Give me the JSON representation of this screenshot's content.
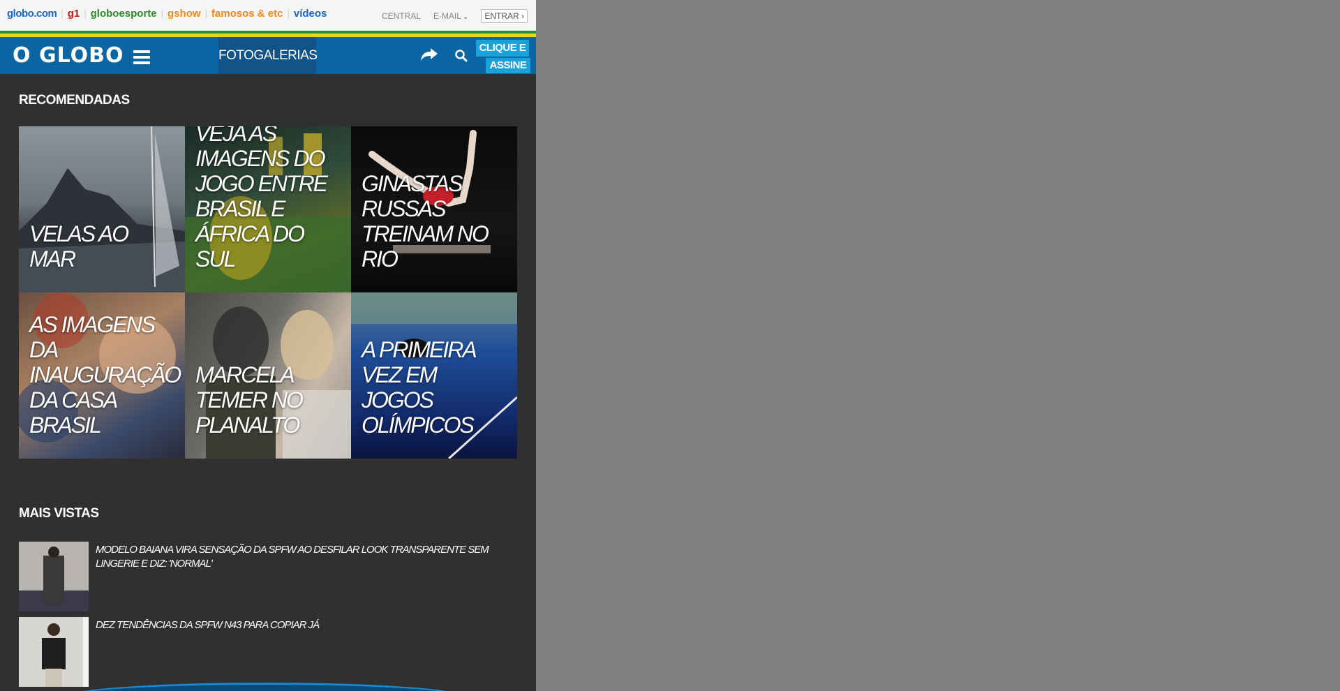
{
  "globo_bar": {
    "links": [
      {
        "label": "globo.com",
        "color": "#1a66c2"
      },
      {
        "label": "g1",
        "color": "#c4170c"
      },
      {
        "label": "globoesporte",
        "color": "#2f8a2c"
      },
      {
        "label": "gshow",
        "color": "#f08a1c"
      },
      {
        "label": "famosos & etc",
        "color": "#f08a1c"
      },
      {
        "label": "vídeos",
        "color": "#1a66c2"
      }
    ],
    "central": "CENTRAL",
    "email": "E-MAIL",
    "entrar": "ENTRAR ›"
  },
  "header": {
    "logo": "O GLOBO",
    "section": "FOTOGALERIAS",
    "assine_line1": "CLIQUE E",
    "assine_line2": "ASSINE"
  },
  "recomendadas": {
    "title": "RECOMENDADAS",
    "items": [
      {
        "caption": "Velas ao mar"
      },
      {
        "caption": "Veja as imagens do jogo entre Brasil e África do Sul"
      },
      {
        "caption": "Ginastas russas treinam no Rio"
      },
      {
        "caption": "As imagens da inauguração da Casa Brasil"
      },
      {
        "caption": "Marcela Temer no Planalto"
      },
      {
        "caption": "A primeira vez em Jogos Olímpicos"
      }
    ]
  },
  "mais_vistas": {
    "title": "MAIS VISTAS",
    "items": [
      {
        "title": "Modelo baiana vira sensação da SPFW ao desfilar look transparente sem lingerie e diz: 'normal'"
      },
      {
        "title": "Dez tendências da SPFW N43 para copiar já"
      }
    ]
  }
}
